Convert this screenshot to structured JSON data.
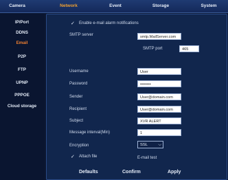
{
  "topnav": {
    "tabs": [
      "Camera",
      "Network",
      "Event",
      "Storage",
      "System"
    ],
    "active": "Network"
  },
  "sidebar": {
    "items": [
      "IP/Port",
      "DDNS",
      "Email",
      "P2P",
      "FTP",
      "UPNP",
      "PPPOE",
      "Cloud storage"
    ],
    "active": "Email"
  },
  "form": {
    "enable_label": "Enable e-mail alarm notifications",
    "smtp_server_label": "SMTP server",
    "smtp_server_value": "smtp.MailServer.com",
    "smtp_port_label": "SMTP port",
    "smtp_port_value": "465",
    "username_label": "Username",
    "username_value": "User",
    "password_label": "Password",
    "password_value": "••••••••",
    "sender_label": "Sender",
    "sender_value": "User@domain.com",
    "recipient_label": "Recipient",
    "recipient_value": "User@domain.com",
    "subject_label": "Subject",
    "subject_value": "XVR ALERT",
    "interval_label": "Message interval(Min)",
    "interval_value": "1",
    "encryption_label": "Encryption",
    "encryption_value": "SSL",
    "attach_label": "Attach file",
    "email_test_label": "E-mail test"
  },
  "buttons": {
    "defaults": "Defaults",
    "confirm": "Confirm",
    "apply": "Apply"
  },
  "icons": {
    "check": "✓",
    "chevron": "⌵"
  }
}
